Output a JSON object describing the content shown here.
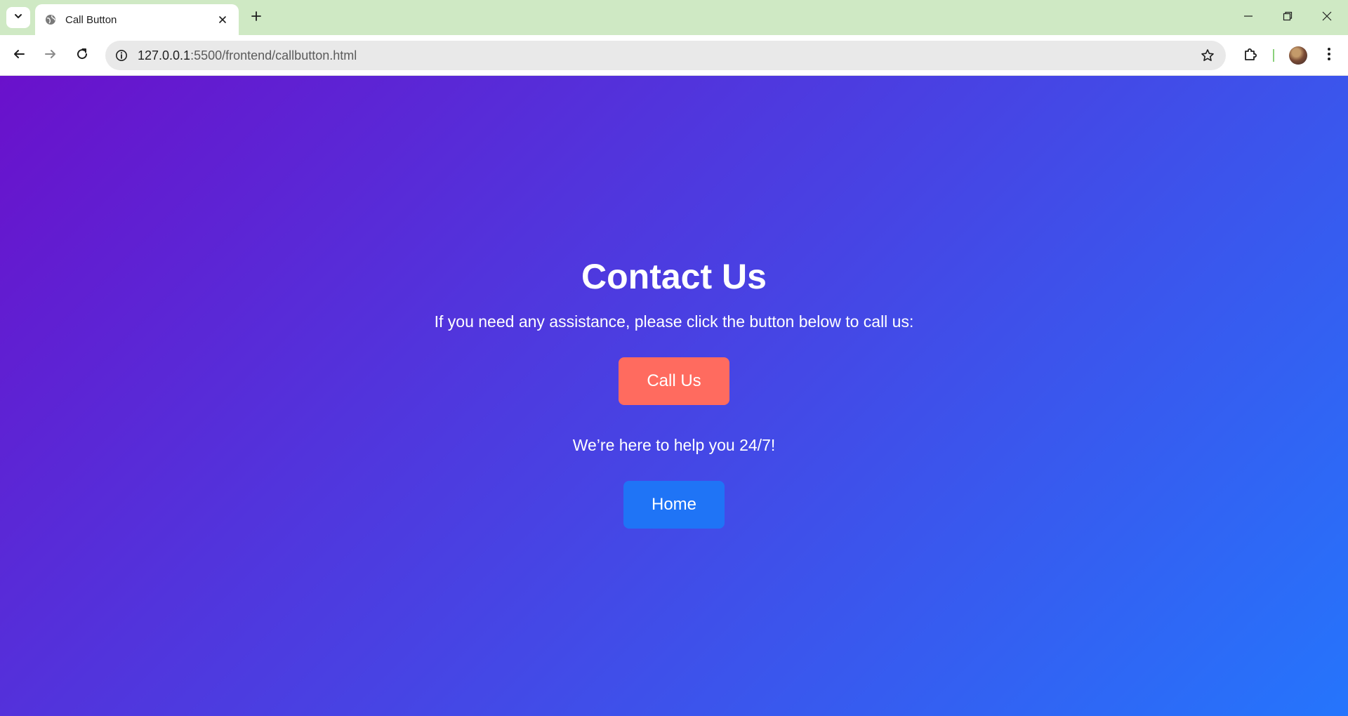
{
  "browser": {
    "tab_title": "Call Button",
    "url_host": "127.0.0.1",
    "url_path": ":5500/frontend/callbutton.html",
    "tabbar_color": "#cfe9c4"
  },
  "page": {
    "heading": "Contact Us",
    "intro_text": "If you need any assistance, please click the button below to call us:",
    "call_button_label": "Call Us",
    "help_text": "We’re here to help you 24/7!",
    "home_button_label": "Home",
    "gradient_start": "#6a11cb",
    "gradient_end": "#2575fc",
    "call_button_color": "#ff6b5f",
    "home_button_color": "#1f74f6"
  }
}
